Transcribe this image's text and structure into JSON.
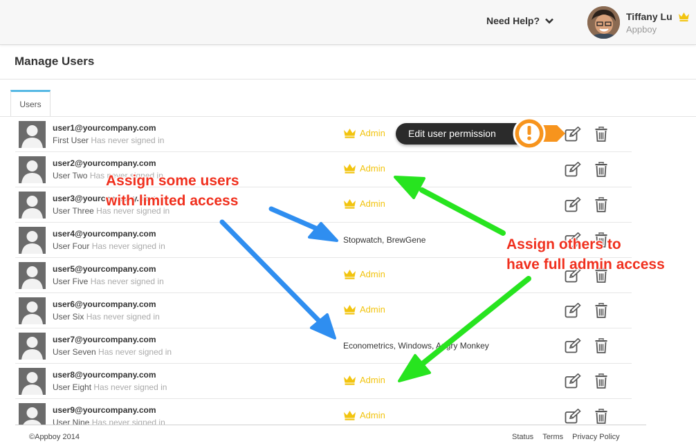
{
  "header": {
    "help_label": "Need Help?",
    "user_name": "Tiffany Lu",
    "company": "Appboy"
  },
  "page": {
    "title": "Manage Users"
  },
  "tabs": [
    {
      "label": "Users"
    }
  ],
  "users": [
    {
      "email": "user1@yourcompany.com",
      "name": "First User",
      "status": "Has never signed in",
      "permission": "Admin",
      "is_admin": true
    },
    {
      "email": "user2@yourcompany.com",
      "name": "User Two",
      "status": "Has never signed in",
      "permission": "Admin",
      "is_admin": true
    },
    {
      "email": "user3@yourcompany.com",
      "name": "User Three",
      "status": "Has never signed in",
      "permission": "Admin",
      "is_admin": true
    },
    {
      "email": "user4@yourcompany.com",
      "name": "User Four",
      "status": "Has never signed in",
      "permission": "Stopwatch, BrewGene",
      "is_admin": false
    },
    {
      "email": "user5@yourcompany.com",
      "name": "User Five",
      "status": "Has never signed in",
      "permission": "Admin",
      "is_admin": true
    },
    {
      "email": "user6@yourcompany.com",
      "name": "User Six",
      "status": "Has never signed in",
      "permission": "Admin",
      "is_admin": true
    },
    {
      "email": "user7@yourcompany.com",
      "name": "User Seven",
      "status": "Has never signed in",
      "permission": "Econometrics, Windows, Angry Monkey",
      "is_admin": false
    },
    {
      "email": "user8@yourcompany.com",
      "name": "User Eight",
      "status": "Has never signed in",
      "permission": "Admin",
      "is_admin": true
    },
    {
      "email": "user9@yourcompany.com",
      "name": "User Nine",
      "status": "Has never signed in",
      "permission": "Admin",
      "is_admin": true
    }
  ],
  "tooltip": {
    "text": "Edit user permission"
  },
  "annotations": {
    "limited": [
      "Assign some users",
      "with limited access"
    ],
    "full": [
      "Assign others to",
      "have full admin access"
    ]
  },
  "footer": {
    "copyright": "©Appboy 2014",
    "links": [
      "Status",
      "Terms",
      "Privacy Policy"
    ]
  },
  "colors": {
    "accent_tab": "#54b8e4",
    "admin_gold": "#f2c40f",
    "callout_red": "#f0301e",
    "arrow_blue": "#2f8ef0",
    "arrow_green": "#27e41f",
    "tooltip_orange": "#f7941d"
  },
  "icons": {
    "help": "chevron-down-icon",
    "admin": "crown-icon",
    "edit": "edit-icon",
    "delete": "trash-icon",
    "tooltip": "exclamation-icon",
    "avatar": "user-silhouette-icon"
  }
}
